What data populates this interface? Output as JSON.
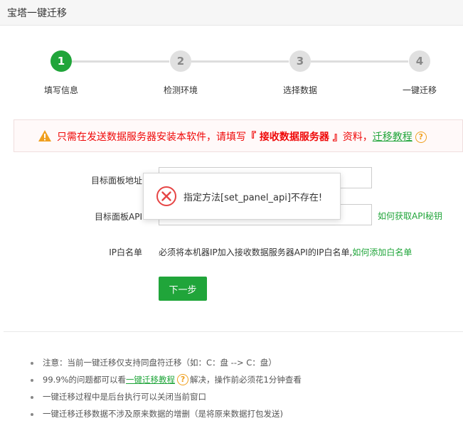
{
  "window": {
    "title": "宝塔一键迁移"
  },
  "steps": [
    {
      "number": "1",
      "label": "填写信息",
      "active": true
    },
    {
      "number": "2",
      "label": "检测环境",
      "active": false
    },
    {
      "number": "3",
      "label": "选择数据",
      "active": false
    },
    {
      "number": "4",
      "label": "一键迁移",
      "active": false
    }
  ],
  "alert": {
    "prefix": "只需在发送数据服务器安装本软件，请填写",
    "highlight": "『 接收数据服务器 』",
    "suffix": "资料，",
    "link": "迁移教程",
    "help": "?"
  },
  "form": {
    "panel_address_label": "目标面板地址",
    "panel_address_value": "",
    "panel_api_label": "目标面板API",
    "panel_api_value": "",
    "get_api_link": "如何获取API秘钥",
    "ip_whitelist_label": "IP白名单",
    "ip_whitelist_hint": "必须将本机器IP加入接收数据服务器API的IP白名单,",
    "ip_whitelist_link": "如何添加白名单",
    "next_button": "下一步"
  },
  "notes": {
    "item1": "注意：当前一键迁移仅支持同盘符迁移（如：C：盘 --> C：盘）",
    "item2_prefix": "99.9%的问题都可以看",
    "item2_link": "一键迁移教程",
    "item2_help": "?",
    "item2_suffix": "解决，操作前必须花1分钟查看",
    "item3": "一键迁移过程中是后台执行可以关闭当前窗口",
    "item4": "一键迁移迁移数据不涉及原来数据的增删（是将原来数据打包发送)"
  },
  "toast": {
    "message": "指定方法[set_panel_api]不存在!",
    "icon": "error-x-icon"
  },
  "colors": {
    "brand_green": "#20a53a",
    "alert_red": "#ef0808",
    "warning_orange": "#f0a020",
    "error_red": "#e64545"
  }
}
